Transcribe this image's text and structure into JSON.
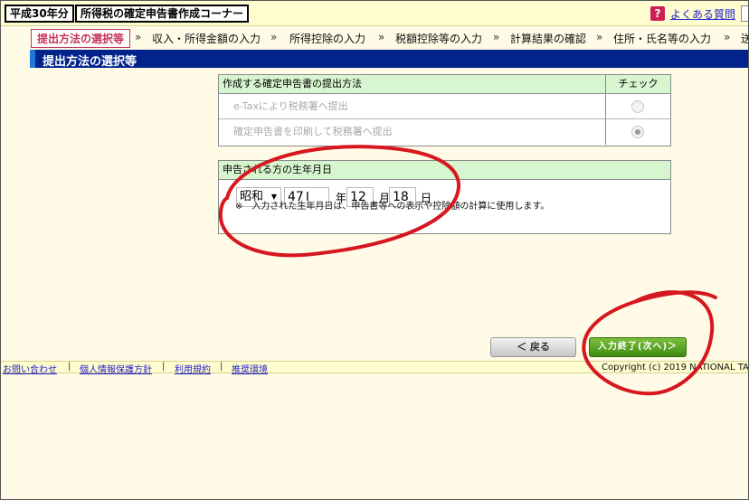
{
  "header": {
    "year_badge": "平成30年分",
    "app_title": "所得税の確定申告書作成コーナー",
    "faq_icon": "?",
    "faq_link": "よくある質問"
  },
  "steps": {
    "items": [
      "提出方法の選択等",
      "収入・所得金額の入力",
      "所得控除の入力",
      "税額控除等の入力",
      "計算結果の確認",
      "住所・氏名等の入力",
      "送"
    ],
    "separator": "»"
  },
  "section": {
    "title": "提出方法の選択等"
  },
  "method_table": {
    "header": "作成する確定申告書の提出方法",
    "check_header": "チェック",
    "options": [
      {
        "label": "e-Taxにより税務署へ提出",
        "checked": false
      },
      {
        "label": "確定申告書を印刷して税務署へ提出",
        "checked": true
      }
    ]
  },
  "birth_table": {
    "header": "申告される方の生年月日",
    "era": "昭和",
    "year": "47",
    "year_unit": "年",
    "month": "12",
    "month_unit": "月",
    "day": "18",
    "day_unit": "日",
    "note": "※　入力された生年月日は、申告書等への表示や控除額の計算に使用します。"
  },
  "buttons": {
    "back": "＜ 戻る",
    "next": "入力終了(次へ)＞"
  },
  "footer": {
    "links": [
      "お問い合わせ",
      "個人情報保護方針",
      "利用規約",
      "推奨環境"
    ],
    "separator": "|",
    "copyright": "Copyright (c) 2019 NATIONAL TA"
  },
  "colors": {
    "nav_blue": "#00238c",
    "active_step": "#c7335a",
    "table_header": "#d7f5cf",
    "next_button": "#4f9a1f",
    "annotation": "#d6171f"
  }
}
